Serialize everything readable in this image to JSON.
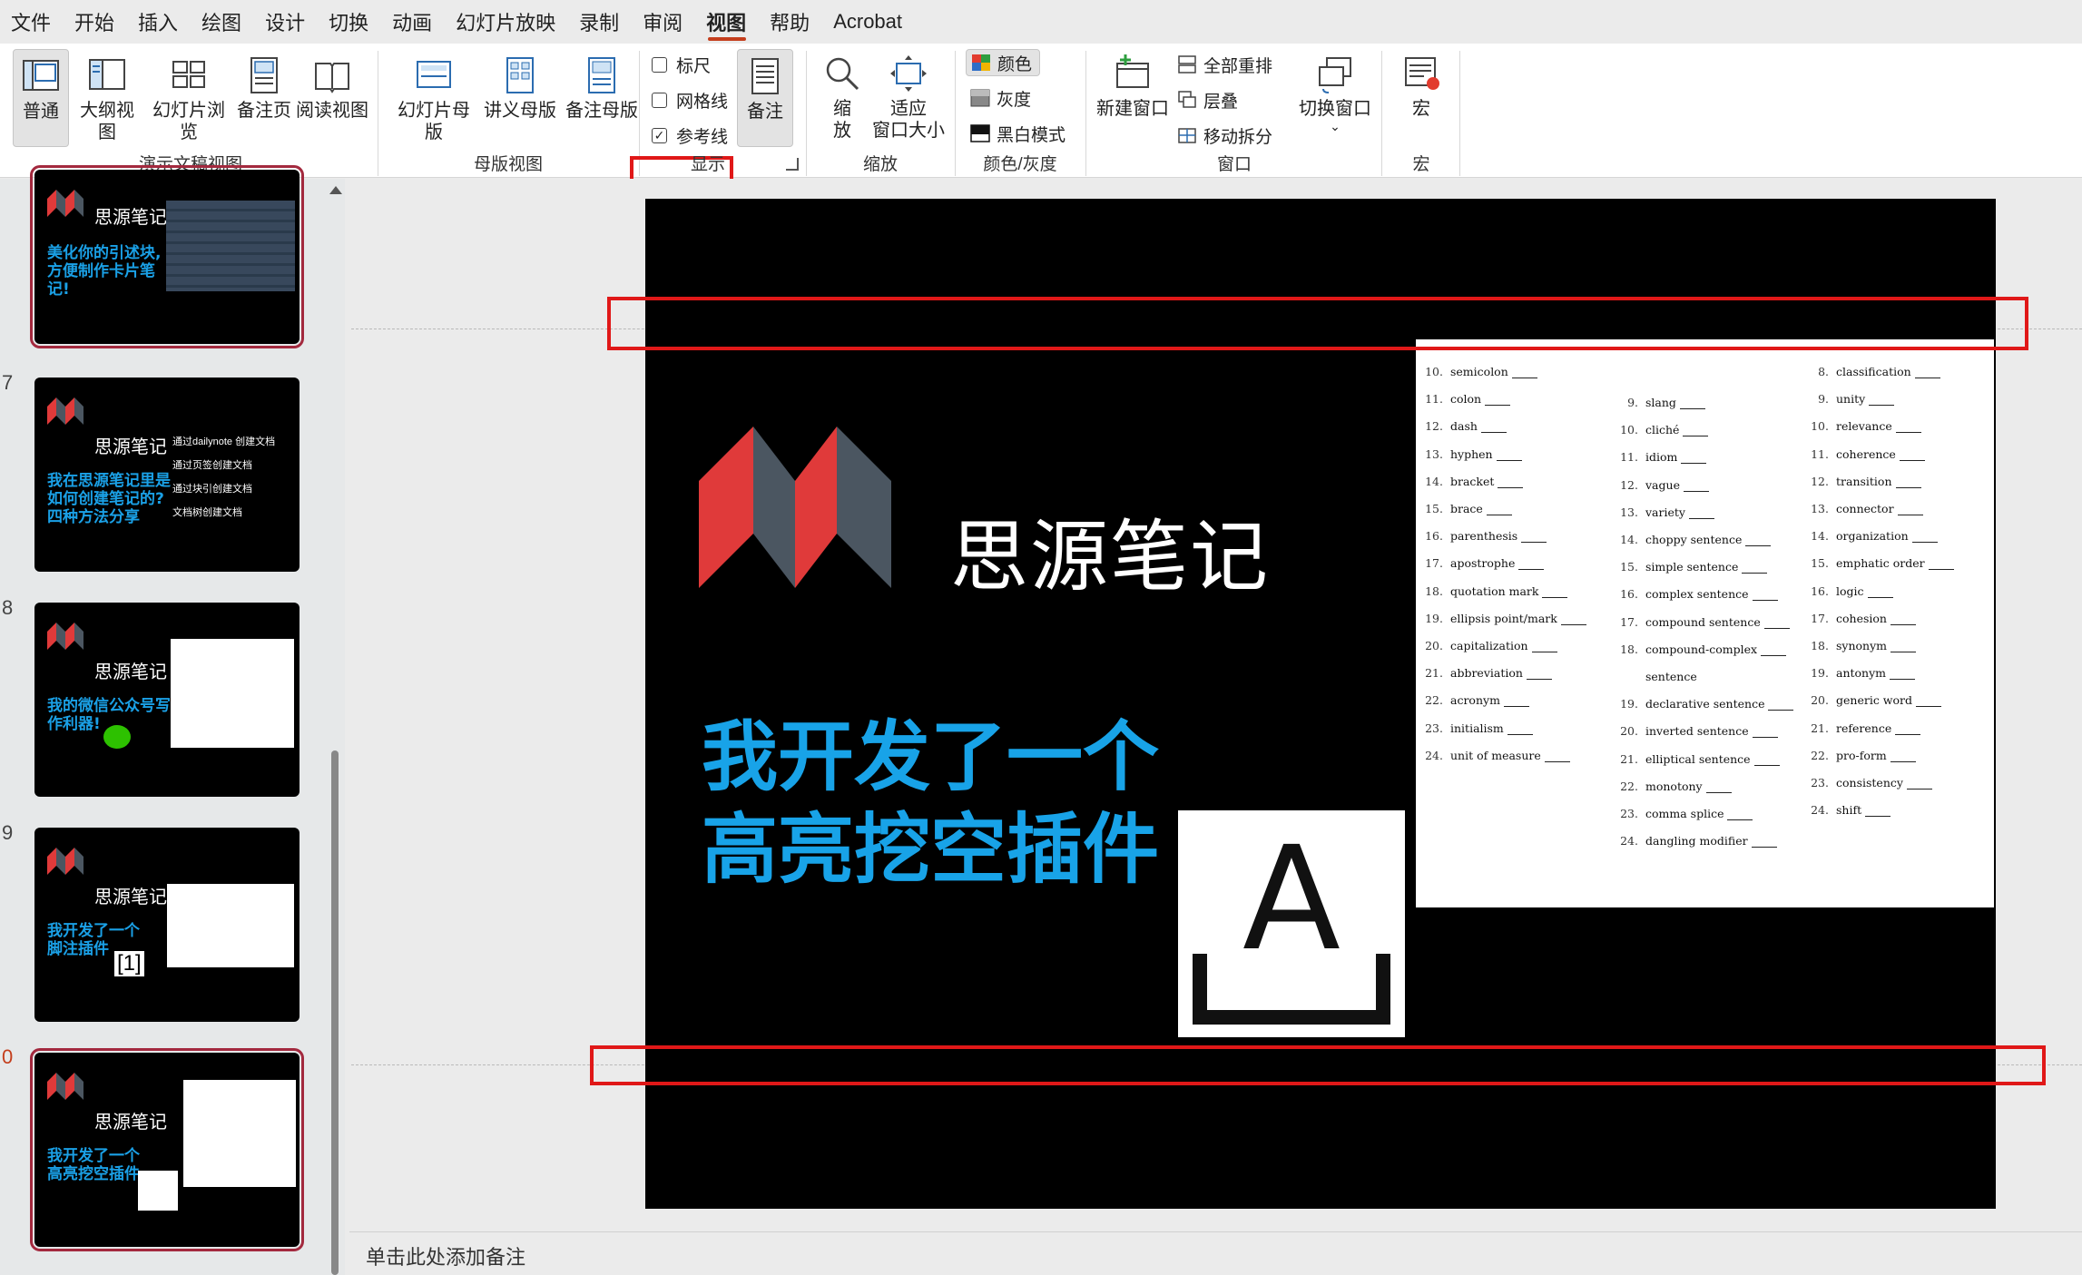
{
  "menu": [
    "文件",
    "开始",
    "插入",
    "绘图",
    "设计",
    "切换",
    "动画",
    "幻灯片放映",
    "录制",
    "审阅",
    "视图",
    "帮助",
    "Acrobat"
  ],
  "active_menu": "视图",
  "ribbon": {
    "pres_views": [
      "普通",
      "大纲视图",
      "幻灯片浏览",
      "备注页",
      "阅读视图"
    ],
    "pres_views_label": "演示文稿视图",
    "master_views": [
      "幻灯片母版",
      "讲义母版",
      "备注母版"
    ],
    "master_views_label": "母版视图",
    "show": {
      "ruler": "标尺",
      "gridlines": "网格线",
      "guides": "参考线",
      "notes": "备注",
      "label": "显示",
      "guides_checked": true
    },
    "zoom": {
      "zoom": "缩\n放",
      "fit": "适应\n窗口大小",
      "label": "缩放"
    },
    "color": {
      "color": "颜色",
      "gray": "灰度",
      "bw": "黑白模式",
      "label": "颜色/灰度"
    },
    "window": {
      "new": "新建窗口",
      "arrange": "全部重排",
      "cascade": "层叠",
      "split": "移动拆分",
      "switch": "切换窗口",
      "label": "窗口"
    },
    "macro": {
      "macro": "宏",
      "label": "宏"
    }
  },
  "thumbs": [
    {
      "num": "",
      "title": "思源笔记",
      "body": "美化你的引述块,\n方便制作卡片笔\n记!"
    },
    {
      "num": "7",
      "title": "思源笔记",
      "body": "我在思源笔记里是\n如何创建笔记的?\n四种方法分享",
      "items": [
        "通过dailynote 创建文档",
        "通过页签创建文档",
        "通过块引创建文档",
        "文档树创建文档"
      ]
    },
    {
      "num": "8",
      "title": "思源笔记",
      "body": "我的微信公众号写\n作利器!"
    },
    {
      "num": "9",
      "title": "思源笔记",
      "body": "我开发了一个\n脚注插件",
      "badge": "[1]"
    },
    {
      "num": "0",
      "title": "思源笔记",
      "body": "我开发了一个\n高亮挖空插件"
    }
  ],
  "slide": {
    "brand": "思源笔记",
    "headline1": "我开发了一个",
    "headline2": "高亮挖空插件",
    "icon_letter": "A",
    "worksheet": {
      "col1": [
        [
          "10.",
          "semicolon"
        ],
        [
          "11.",
          "colon"
        ],
        [
          "12.",
          "dash"
        ],
        [
          "13.",
          "hyphen"
        ],
        [
          "14.",
          "bracket"
        ],
        [
          "15.",
          "brace"
        ],
        [
          "16.",
          "parenthesis"
        ],
        [
          "17.",
          "apostrophe"
        ],
        [
          "18.",
          "quotation mark"
        ],
        [
          "19.",
          "ellipsis point/mark"
        ],
        [
          "20.",
          "capitalization"
        ],
        [
          "21.",
          "abbreviation"
        ],
        [
          "22.",
          "acronym"
        ],
        [
          "23.",
          "initialism"
        ],
        [
          "24.",
          "unit of measure"
        ]
      ],
      "col2": [
        [
          "9.",
          "slang"
        ],
        [
          "10.",
          "cliché"
        ],
        [
          "11.",
          "idiom"
        ],
        [
          "12.",
          "vague"
        ],
        [
          "13.",
          "variety"
        ],
        [
          "14.",
          "choppy sentence"
        ],
        [
          "15.",
          "simple sentence"
        ],
        [
          "16.",
          "complex sentence"
        ],
        [
          "17.",
          "compound sentence"
        ],
        [
          "18.",
          "compound-complex"
        ],
        [
          "",
          "sentence"
        ],
        [
          "19.",
          "declarative sentence"
        ],
        [
          "20.",
          "inverted sentence"
        ],
        [
          "21.",
          "elliptical sentence"
        ],
        [
          "22.",
          "monotony"
        ],
        [
          "23.",
          "comma splice"
        ],
        [
          "24.",
          "dangling modifier"
        ]
      ],
      "col3": [
        [
          "8.",
          "classification"
        ],
        [
          "9.",
          "unity"
        ],
        [
          "10.",
          "relevance"
        ],
        [
          "11.",
          "coherence"
        ],
        [
          "12.",
          "transition"
        ],
        [
          "13.",
          "connector"
        ],
        [
          "14.",
          "organization"
        ],
        [
          "15.",
          "emphatic order"
        ],
        [
          "16.",
          "logic"
        ],
        [
          "17.",
          "cohesion"
        ],
        [
          "18.",
          "synonym"
        ],
        [
          "19.",
          "antonym"
        ],
        [
          "20.",
          "generic word"
        ],
        [
          "21.",
          "reference"
        ],
        [
          "22.",
          "pro-form"
        ],
        [
          "23.",
          "consistency"
        ],
        [
          "24.",
          "shift"
        ]
      ]
    }
  },
  "notes_placeholder": "单击此处添加备注"
}
